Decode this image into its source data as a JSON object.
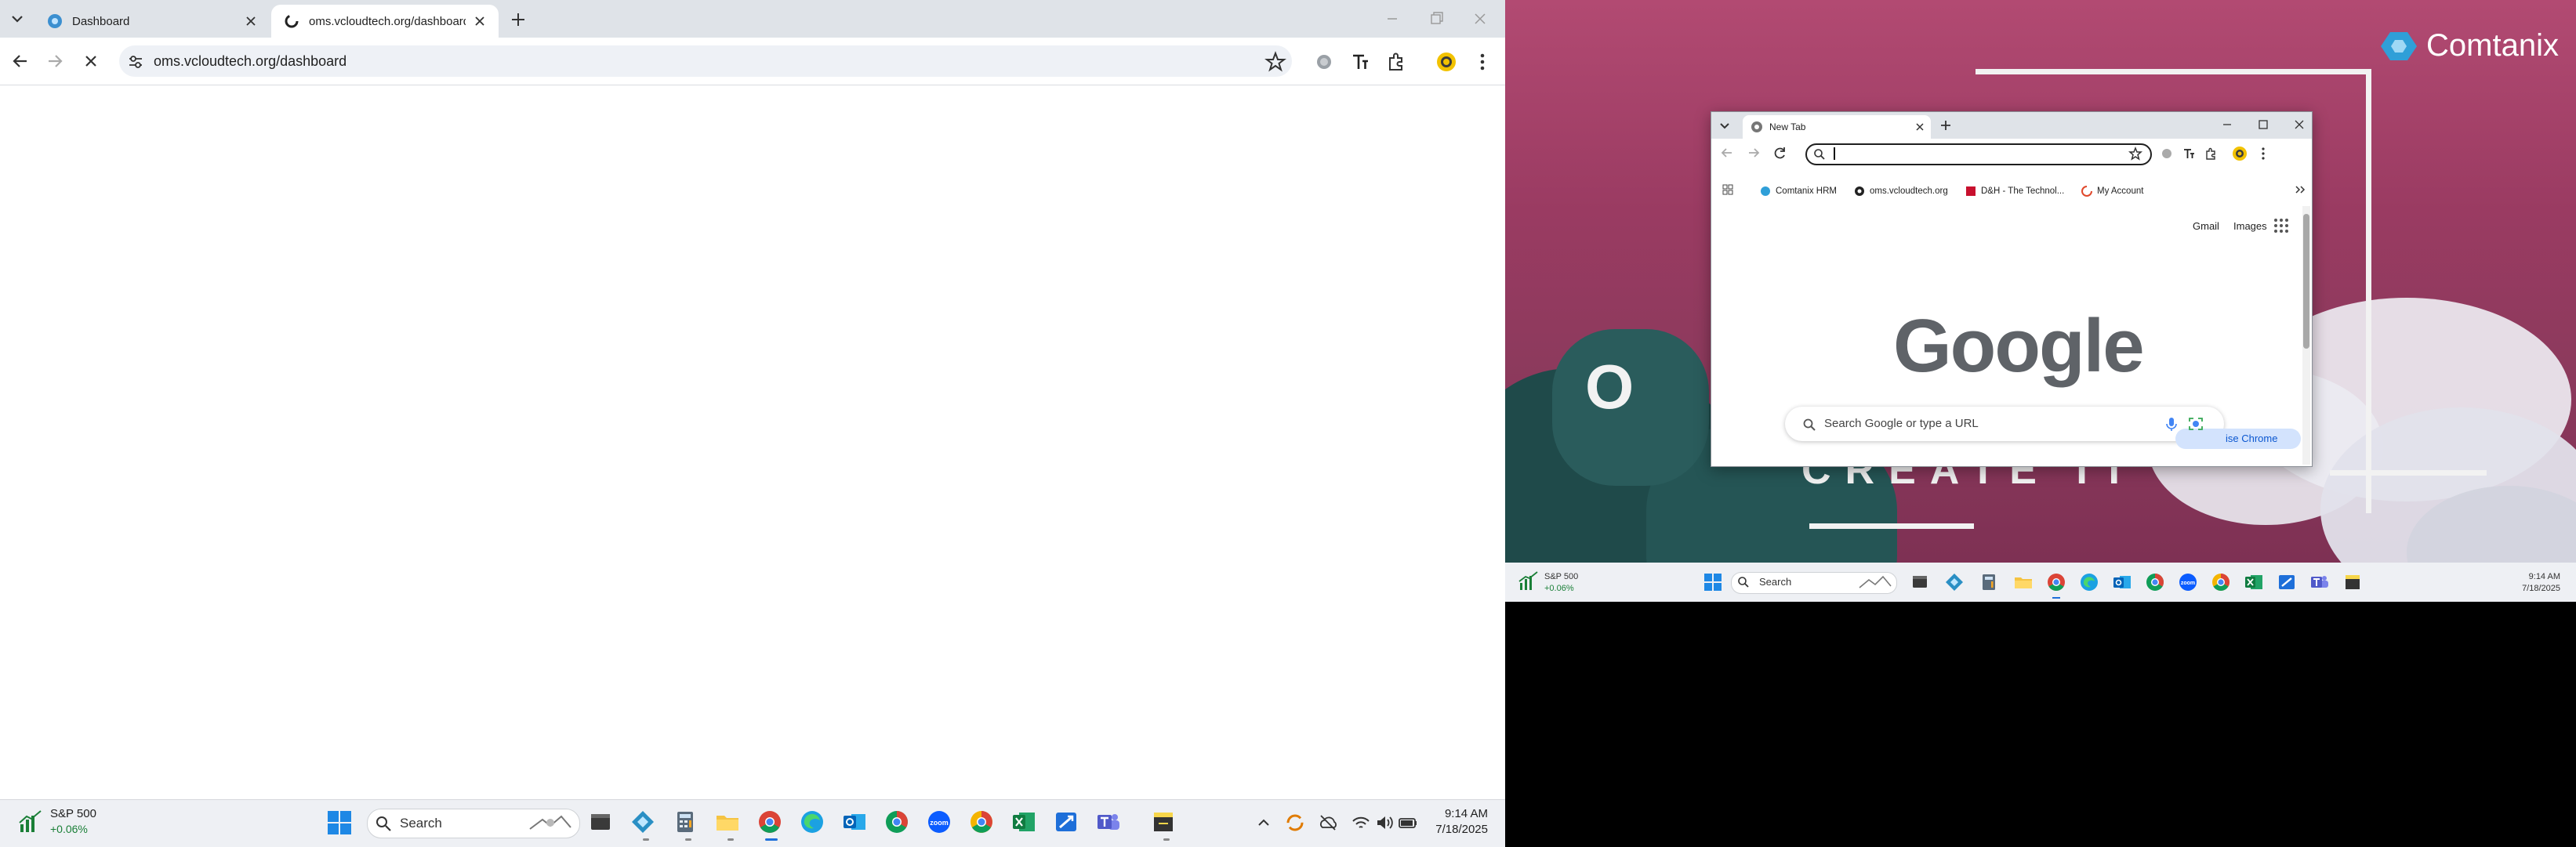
{
  "left_browser": {
    "tabs": [
      {
        "title": "Dashboard",
        "active": false
      },
      {
        "title": "oms.vcloudtech.org/dashboard",
        "active": true
      }
    ],
    "url": "oms.vcloudtech.org/dashboard"
  },
  "left_taskbar": {
    "widget_title": "S&P 500",
    "widget_change": "+0.06%",
    "search_placeholder": "Search",
    "time": "9:14 AM",
    "date": "7/18/2025",
    "apps": [
      "windows-start",
      "file-explorer-dark",
      "vcloud-app",
      "calculator",
      "file-explorer",
      "chrome-active",
      "edge",
      "outlook",
      "chrome-2",
      "zoom",
      "chrome-3",
      "excel",
      "remote-desktop",
      "teams",
      "sticky-notes"
    ]
  },
  "right_desktop": {
    "brand_name": "Comtanix",
    "wallpaper_partial_text_1": "O",
    "wallpaper_partial_text_2": "CREATE IT"
  },
  "inner_browser": {
    "tab_title": "New Tab",
    "bookmarks": [
      {
        "label": "Comtanix HRM"
      },
      {
        "label": "oms.vcloudtech.org"
      },
      {
        "label": "D&H - The Technol..."
      },
      {
        "label": "My Account"
      }
    ],
    "links": {
      "gmail": "Gmail",
      "images": "Images"
    },
    "logo_text": "Google",
    "search_placeholder": "Search Google or type a URL",
    "customize_label": "ise Chrome"
  },
  "right_taskbar": {
    "widget_title": "S&P 500",
    "widget_change": "+0.06%",
    "search_placeholder": "Search",
    "time": "9:14 AM",
    "date": "7/18/2025"
  },
  "colors": {
    "google_blue": "#4285F4",
    "google_red": "#EA4335",
    "google_yellow": "#FBBC05",
    "google_green": "#34A853",
    "chrome_frame": "#dfe3e8"
  }
}
